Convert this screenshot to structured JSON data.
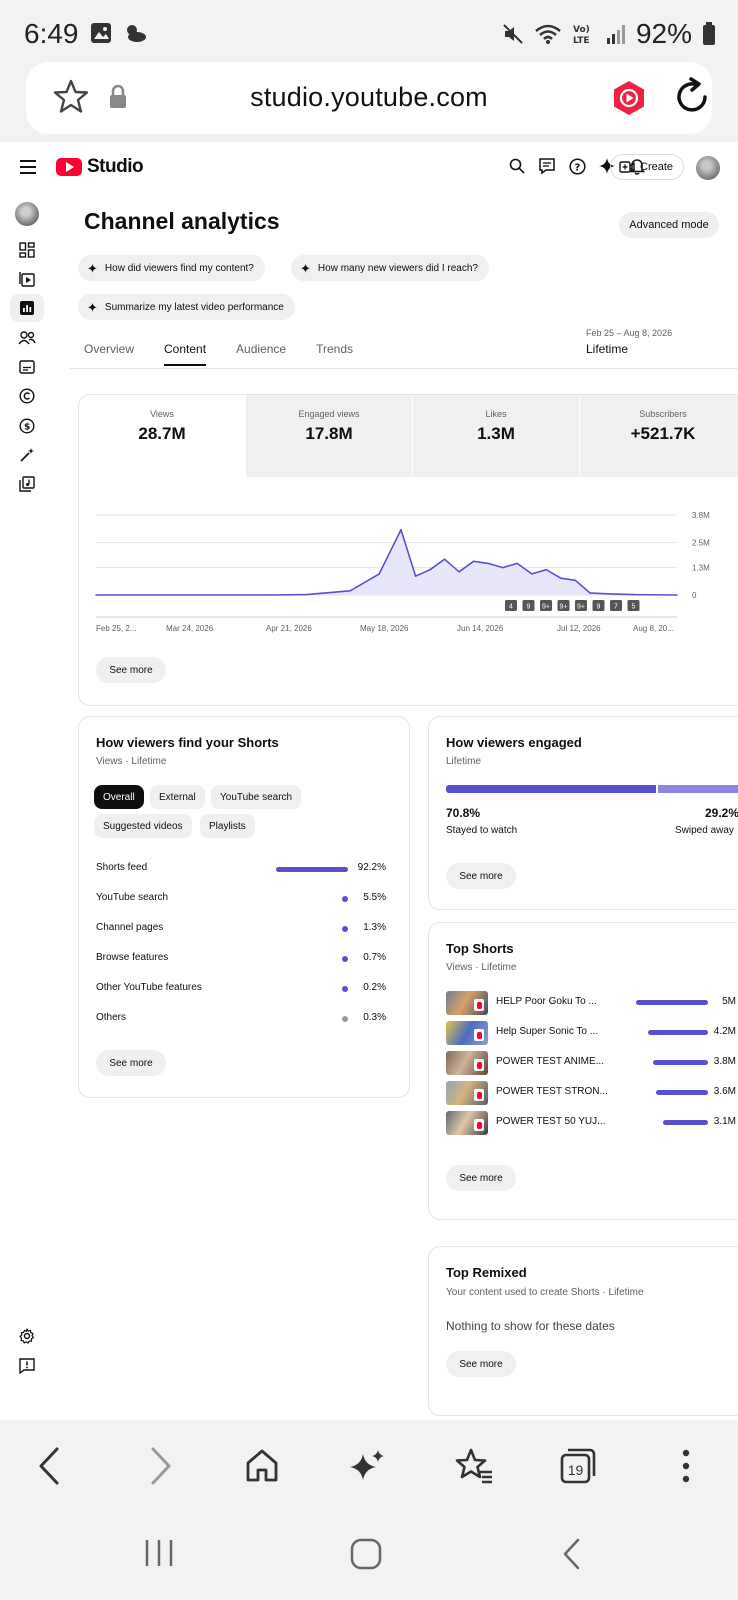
{
  "status_bar": {
    "time": "6:49",
    "battery": "92%",
    "network": "VoLTE"
  },
  "browser": {
    "url": "studio.youtube.com",
    "tabs_count": "19"
  },
  "header": {
    "logo_text": "Studio",
    "create_label": "Create"
  },
  "page": {
    "title": "Channel analytics",
    "advanced_mode": "Advanced mode",
    "chips": [
      "How did viewers find my content?",
      "How many new viewers did I reach?",
      "Summarize my latest video performance"
    ],
    "tabs": [
      "Overview",
      "Content",
      "Audience",
      "Trends"
    ],
    "active_tab": "Content",
    "date_range": "Feb 25 – Aug 8, 2026",
    "date_label": "Lifetime"
  },
  "metrics": [
    {
      "label": "Views",
      "value": "28.7M"
    },
    {
      "label": "Engaged views",
      "value": "17.8M"
    },
    {
      "label": "Likes",
      "value": "1.3M"
    },
    {
      "label": "Subscribers",
      "value": "+521.7K"
    }
  ],
  "chart_data": {
    "type": "line",
    "title": "",
    "xlabel": "",
    "ylabel": "",
    "x_tick_labels": [
      "Feb 25, 2...",
      "Mar 24, 2026",
      "Apr 21, 2026",
      "May 18, 2026",
      "Jun 14, 2026",
      "Jul 12, 2026",
      "Aug 8, 20..."
    ],
    "y_tick_labels": [
      "3.8M",
      "2.5M",
      "1.3M",
      "0"
    ],
    "ylim": [
      0,
      3800000
    ],
    "series": [
      {
        "x_index": [
          0,
          24,
          29,
          35,
          39,
          42,
          44,
          46,
          48,
          50,
          52,
          54,
          56,
          58,
          60,
          62,
          64,
          66,
          68,
          70,
          72,
          74,
          80
        ],
        "x_dates": [
          "2026-02-25",
          "2026-06-24",
          "2026-06-29",
          "2026-07-03",
          "2026-07-05",
          "2026-07-07",
          "2026-07-08",
          "2026-07-09",
          "2026-07-10",
          "2026-07-11",
          "2026-07-12",
          "2026-07-13",
          "2026-07-14",
          "2026-07-15",
          "2026-07-16",
          "2026-07-17",
          "2026-07-18",
          "2026-07-19",
          "2026-07-20",
          "2026-07-21",
          "2026-07-22",
          "2026-07-25",
          "2026-08-08"
        ],
        "values": [
          0,
          0,
          20000,
          200000,
          1000000,
          3100000,
          900000,
          1200000,
          1700000,
          1100000,
          1600000,
          1500000,
          1300000,
          1500000,
          1000000,
          1200000,
          800000,
          700000,
          100000,
          60000,
          40000,
          20000,
          0
        ]
      }
    ],
    "annotations": [
      "4",
      "9",
      "9+",
      "9+",
      "9+",
      "9",
      "7",
      "5"
    ],
    "grid": true
  },
  "see_more": "See more",
  "shorts_sources": {
    "title": "How viewers find your Shorts",
    "subtitle": "Views · Lifetime",
    "filters": [
      "Overall",
      "External",
      "YouTube search",
      "Suggested videos",
      "Playlists"
    ],
    "rows": [
      {
        "label": "Shorts feed",
        "value": "92.2%",
        "pct": 92.2
      },
      {
        "label": "YouTube search",
        "value": "5.5%",
        "pct": 5.5
      },
      {
        "label": "Channel pages",
        "value": "1.3%",
        "pct": 1.3
      },
      {
        "label": "Browse features",
        "value": "0.7%",
        "pct": 0.7
      },
      {
        "label": "Other YouTube features",
        "value": "0.2%",
        "pct": 0.2
      },
      {
        "label": "Others",
        "value": "0.3%",
        "pct": 0.3
      }
    ]
  },
  "engaged": {
    "title": "How viewers engaged",
    "subtitle": "Lifetime",
    "stayed_pct": "70.8%",
    "stayed_label": "Stayed to watch",
    "stayed_fraction": 0.708,
    "swiped_pct": "29.2%",
    "swiped_label": "Swiped away"
  },
  "top_shorts": {
    "title": "Top Shorts",
    "subtitle": "Views · Lifetime",
    "items": [
      {
        "title": "HELP Poor Goku To ...",
        "views": "5M",
        "value": 5.0
      },
      {
        "title": "Help Super Sonic To ...",
        "views": "4.2M",
        "value": 4.2
      },
      {
        "title": "POWER TEST ANIME...",
        "views": "3.8M",
        "value": 3.8
      },
      {
        "title": "POWER TEST STRON...",
        "views": "3.6M",
        "value": 3.6
      },
      {
        "title": "POWER TEST 50 YUJ...",
        "views": "3.1M",
        "value": 3.1
      }
    ]
  },
  "top_remixed": {
    "title": "Top Remixed",
    "subtitle": "Your content used to create Shorts · Lifetime",
    "empty": "Nothing to show for these dates"
  },
  "colors": {
    "accent": "#5a4fcf",
    "accent_light": "#8d86e0",
    "brand": "#ff0033"
  }
}
